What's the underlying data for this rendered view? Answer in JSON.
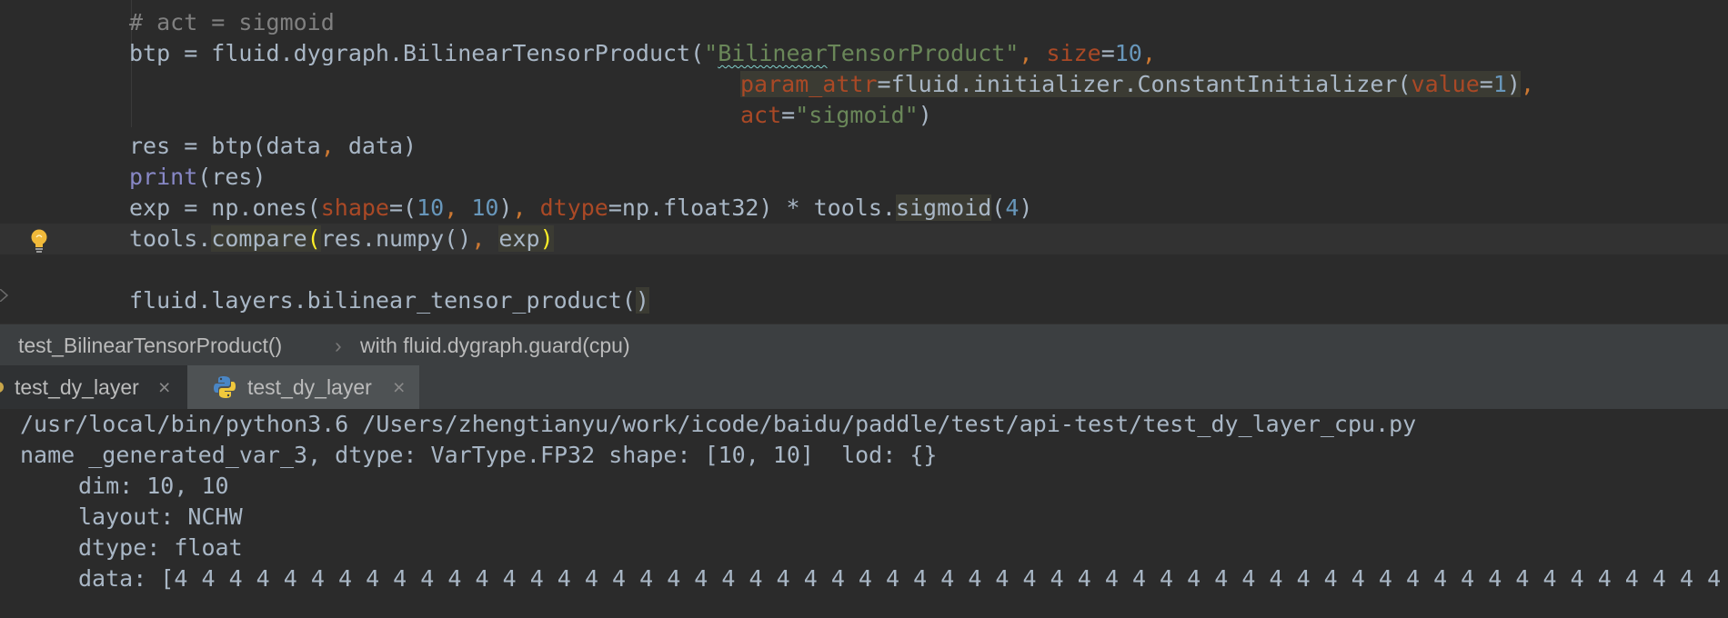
{
  "editor": {
    "lines": [
      {
        "parts": [
          "# act = sigmoid"
        ]
      },
      {
        "parts": [
          "btp = fluid.dygraph.BilinearTensorProduct(",
          "\"BilinearTensorProduct\"",
          ", ",
          "size",
          "=",
          "10",
          ","
        ]
      },
      {
        "parts": [
          "param_attr",
          "=fluid.initializer.ConstantInitializer(",
          "value",
          "=",
          "1",
          ")",
          ","
        ]
      },
      {
        "parts": [
          "act",
          "=",
          "\"sigmoid\"",
          ")"
        ]
      },
      {
        "parts": [
          "res = btp(data",
          ", ",
          "data)"
        ]
      },
      {
        "parts": [
          "print",
          "(res)"
        ]
      },
      {
        "parts": [
          "exp = np.ones(",
          "shape",
          "=(",
          "10",
          ", ",
          "10",
          ")",
          ", ",
          "dtype",
          "=np.float32) * tools.",
          "sigmoid",
          "(",
          "4",
          ")"
        ]
      },
      {
        "parts": [
          "tools.",
          "compare",
          "(",
          "res.numpy()",
          ", ",
          "exp",
          ")"
        ]
      },
      {
        "parts": [
          ""
        ]
      },
      {
        "parts": [
          "fluid.layers.bilinear_tensor_product(",
          ")"
        ]
      }
    ]
  },
  "breadcrumbs": {
    "item1": "test_BilinearTensorProduct()",
    "separator": "›",
    "item2": "with fluid.dygraph.guard(cpu)"
  },
  "tabs": [
    {
      "label": "test_dy_layer",
      "close": "×",
      "icon": "run-config-icon",
      "active": false
    },
    {
      "label": "test_dy_layer",
      "close": "×",
      "icon": "python-icon",
      "active": true
    }
  ],
  "console": {
    "lines": [
      "/usr/local/bin/python3.6 /Users/zhengtianyu/work/icode/baidu/paddle/test/api-test/test_dy_layer_cpu.py",
      "name _generated_var_3, dtype: VarType.FP32 shape: [10, 10]  lod: {}",
      "dim: 10, 10",
      "layout: NCHW",
      "dtype: float",
      "data: [4 4 4 4 4 4 4 4 4 4 4 4 4 4 4 4 4 4 4 4 4 4 4 4 4 4 4 4 4 4 4 4 4 4 4 4 4 4 4 4 4 4 4 4 4 4 4 4 4 4 4 4 4 4 4 4 4"
    ]
  },
  "colors": {
    "background": "#2b2b2b",
    "keyword": "#cc7832",
    "string": "#6a8759",
    "number": "#6897bb",
    "comment": "#808080",
    "param": "#aa4926",
    "builtin": "#8888c6"
  }
}
